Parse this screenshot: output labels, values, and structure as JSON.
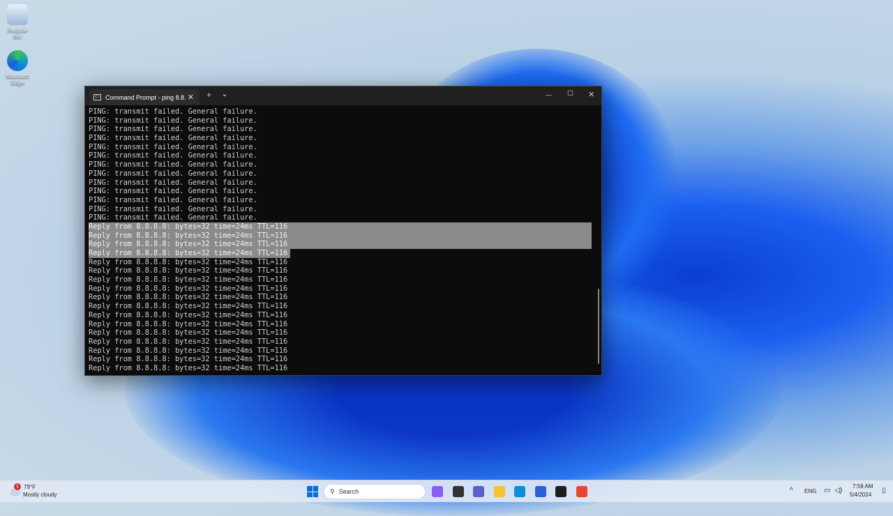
{
  "desktop": {
    "icons": [
      {
        "label": "Recycle Bin"
      },
      {
        "label": "Microsoft Edge"
      }
    ]
  },
  "window": {
    "tab_title": "Command Prompt - ping  8.8.",
    "tab_icon": "cmd-icon",
    "new_tab": "+",
    "dropdown": "⌄",
    "minimize": "—",
    "maximize": "☐",
    "close": "✕"
  },
  "terminal": {
    "failure_lines": [
      "PING: transmit failed. General failure.",
      "PING: transmit failed. General failure.",
      "PING: transmit failed. General failure.",
      "PING: transmit failed. General failure.",
      "PING: transmit failed. General failure.",
      "PING: transmit failed. General failure.",
      "PING: transmit failed. General failure.",
      "PING: transmit failed. General failure.",
      "PING: transmit failed. General failure.",
      "PING: transmit failed. General failure.",
      "PING: transmit failed. General failure.",
      "PING: transmit failed. General failure.",
      "PING: transmit failed. General failure."
    ],
    "reply_lines": [
      "Reply from 8.8.8.8: bytes=32 time=24ms TTL=116",
      "Reply from 8.8.8.8: bytes=32 time=24ms TTL=116",
      "Reply from 8.8.8.8: bytes=32 time=24ms TTL=116",
      "Reply from 8.8.8.8: bytes=32 time=24ms TTL=116",
      "Reply from 8.8.8.8: bytes=32 time=24ms TTL=116",
      "Reply from 8.8.8.8: bytes=32 time=24ms TTL=116",
      "Reply from 8.8.8.8: bytes=32 time=24ms TTL=116",
      "Reply from 8.8.8.8: bytes=32 time=24ms TTL=116",
      "Reply from 8.8.8.8: bytes=32 time=24ms TTL=116",
      "Reply from 8.8.8.8: bytes=32 time=24ms TTL=116",
      "Reply from 8.8.8.8: bytes=32 time=24ms TTL=116",
      "Reply from 8.8.8.8: bytes=32 time=24ms TTL=116",
      "Reply from 8.8.8.8: bytes=32 time=24ms TTL=116",
      "Reply from 8.8.8.8: bytes=32 time=24ms TTL=116",
      "Reply from 8.8.8.8: bytes=32 time=24ms TTL=116",
      "Reply from 8.8.8.8: bytes=32 time=24ms TTL=116",
      "Reply from 8.8.8.8: bytes=32 time=24ms TTL=116"
    ],
    "selected_reply_count": 4
  },
  "taskbar": {
    "weather": {
      "temp": "79°F",
      "condition": "Mostly cloudy",
      "badge": "1"
    },
    "search_label": "Search",
    "tray": {
      "chevron": "^",
      "lang": "ENG",
      "time": "7:59 AM",
      "date": "5/4/2024"
    },
    "apps": [
      {
        "name": "copilot",
        "color": "#8b5cf6"
      },
      {
        "name": "task-view",
        "color": "#333333"
      },
      {
        "name": "teams",
        "color": "#5b5fc7"
      },
      {
        "name": "file-explorer",
        "color": "#f4c430"
      },
      {
        "name": "edge",
        "color": "#0c8fd6"
      },
      {
        "name": "store",
        "color": "#2b5fd9"
      },
      {
        "name": "terminal",
        "color": "#1e1e1e"
      },
      {
        "name": "recorder",
        "color": "#e8442e"
      }
    ]
  }
}
